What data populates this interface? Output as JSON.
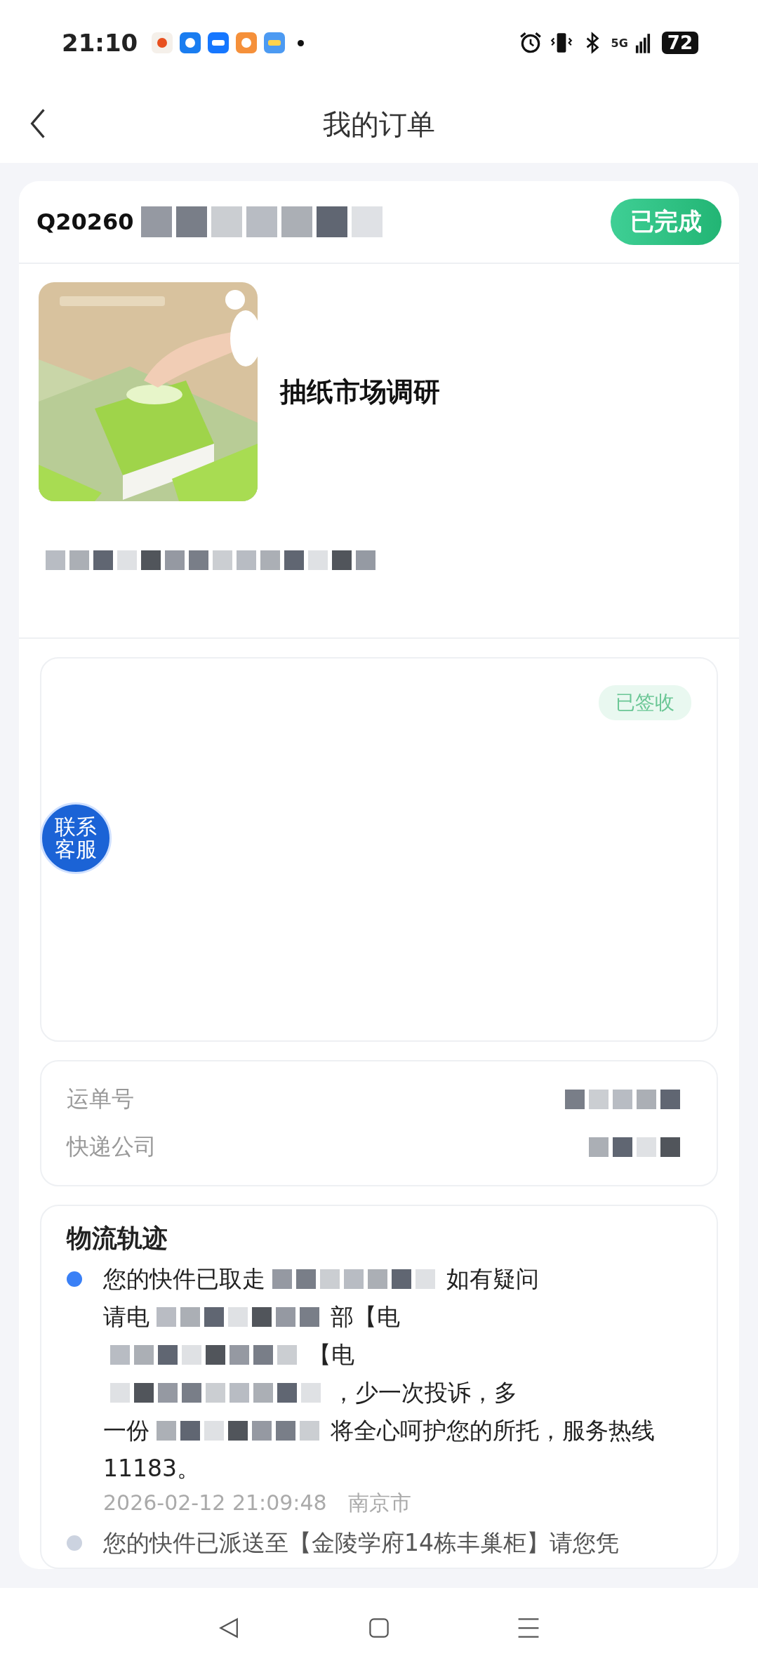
{
  "status_bar": {
    "time": "21:10",
    "network": "5G",
    "battery": "72"
  },
  "header": {
    "title": "我的订单"
  },
  "order": {
    "number": "Q20260",
    "status": "已完成",
    "product_title": "抽纸市场调研"
  },
  "delivery_card": {
    "status": "已签收"
  },
  "contact_button": {
    "label": "联系客服"
  },
  "shipment": {
    "rows": [
      {
        "label": "运单号"
      },
      {
        "label": "快递公司"
      }
    ]
  },
  "tracking": {
    "title": "物流轨迹",
    "events": [
      {
        "latest": true,
        "lines": [
          [
            {
              "kind": "text",
              "text": "您的快件已取走"
            },
            {
              "kind": "redacted"
            },
            {
              "kind": "text",
              "text": "如有疑问"
            }
          ],
          [
            {
              "kind": "text",
              "text": "请电"
            },
            {
              "kind": "redacted"
            },
            {
              "kind": "text",
              "text": "部【电"
            }
          ],
          [
            {
              "kind": "redacted"
            },
            {
              "kind": "text",
              "text": "【电"
            }
          ],
          [
            {
              "kind": "redacted"
            },
            {
              "kind": "text",
              "text": "，少一次投诉，多"
            }
          ],
          [
            {
              "kind": "text",
              "text": "一份"
            },
            {
              "kind": "redacted"
            },
            {
              "kind": "text",
              "text": "将全心呵护您的所托，服务热线"
            }
          ],
          [
            {
              "kind": "text",
              "text": "11183。"
            }
          ]
        ],
        "time": "2026-02-12 21:09:48",
        "city": "南京市"
      },
      {
        "latest": false,
        "lines": [
          [
            {
              "kind": "text",
              "text": "您的快件已派送至【金陵学府14栋丰巢柜】"
            },
            {
              "kind": "text",
              "text": "请您凭"
            }
          ]
        ]
      }
    ]
  }
}
